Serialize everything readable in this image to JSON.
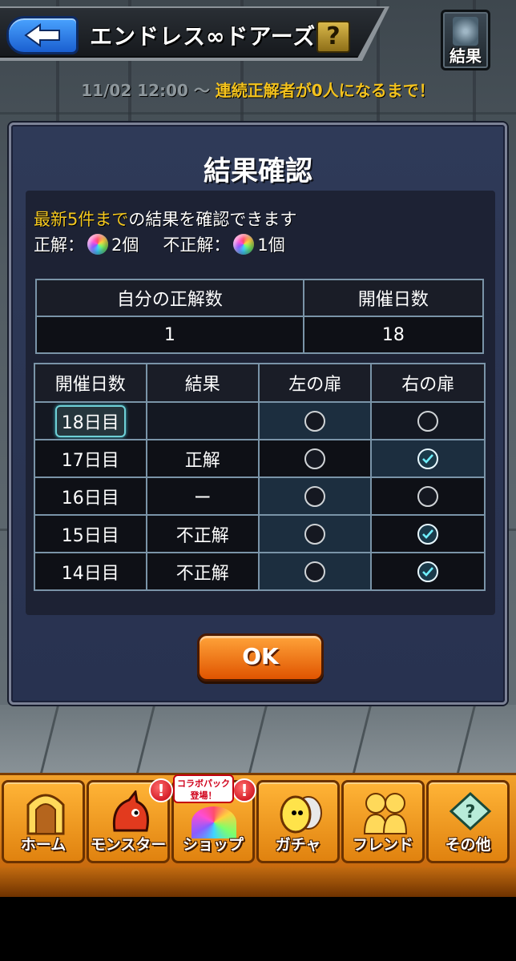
{
  "header": {
    "title": "エンドレス∞ドアーズ",
    "help_label": "?",
    "result_label": "結果"
  },
  "event_period": {
    "datetime": "11/02 12:00 〜",
    "condition": "連続正解者が0人になるまで！"
  },
  "modal": {
    "title": "結果確認",
    "note_highlight": "最新5件まで",
    "note_rest": "の結果を確認できます",
    "correct_label": "正解：",
    "correct_count": "2個",
    "incorrect_label": "不正解：",
    "incorrect_count": "1個",
    "summary": {
      "headers": [
        "自分の正解数",
        "開催日数"
      ],
      "values": [
        "1",
        "18"
      ]
    },
    "history": {
      "headers": [
        "開催日数",
        "結果",
        "左の扉",
        "右の扉"
      ],
      "rows": [
        {
          "day": "18日目",
          "result": "",
          "left": "empty",
          "right": "empty"
        },
        {
          "day": "17日目",
          "result": "正解",
          "left": "empty",
          "right": "checked"
        },
        {
          "day": "16日目",
          "result": "ー",
          "left": "empty",
          "right": "empty"
        },
        {
          "day": "15日目",
          "result": "不正解",
          "left": "empty",
          "right": "checked"
        },
        {
          "day": "14日目",
          "result": "不正解",
          "left": "empty",
          "right": "checked"
        }
      ]
    },
    "ok_label": "OK"
  },
  "nav": {
    "items": [
      {
        "label": "ホーム",
        "icon": "door-icon"
      },
      {
        "label": "モンスター",
        "icon": "monster-icon"
      },
      {
        "label": "ショップ",
        "icon": "orb-icon"
      },
      {
        "label": "ガチャ",
        "icon": "egg-icon"
      },
      {
        "label": "フレンド",
        "icon": "friends-icon"
      },
      {
        "label": "その他",
        "icon": "other-icon"
      }
    ],
    "collab_banner": "コラボパック\n登場！",
    "badge": "!"
  },
  "colors": {
    "accent_yellow": "#f4c81f",
    "modal_bg": "#2f3a58",
    "ok_orange": "#e05400",
    "nav_orange": "#f2a12a"
  }
}
